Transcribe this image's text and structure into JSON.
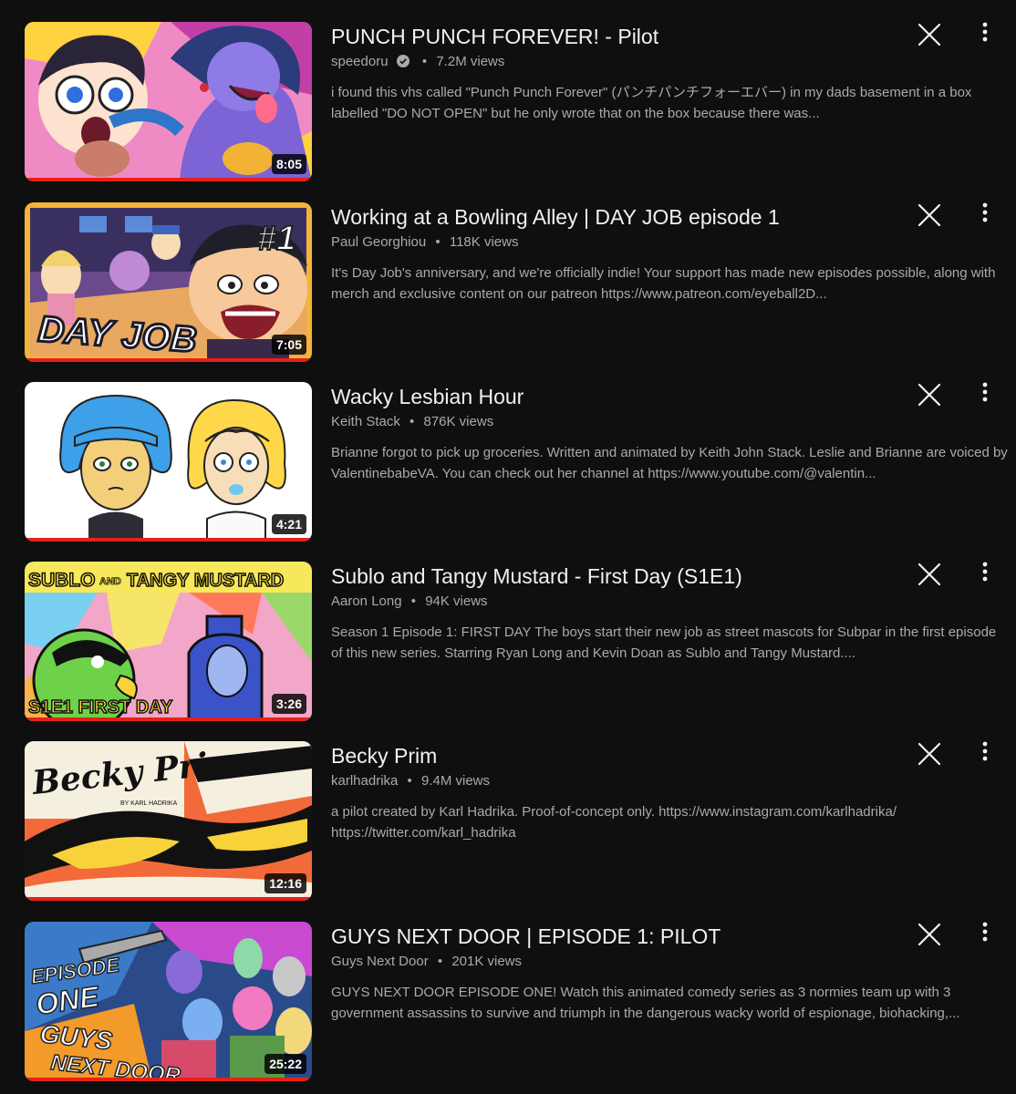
{
  "videos": [
    {
      "title": "PUNCH PUNCH FOREVER! - Pilot",
      "channel": "speedoru",
      "verified": true,
      "views": "7.2M views",
      "description": "i found this vhs called \"Punch Punch Forever\" (パンチパンチフォーエバー) in my dads basement in a box labelled \"DO NOT OPEN\" but he only wrote that on the box because there was...",
      "duration": "8:05",
      "thumbnail": "punch-punch-forever-thumbnail"
    },
    {
      "title": "Working at a Bowling Alley | DAY JOB episode 1",
      "channel": "Paul Georghiou",
      "verified": false,
      "views": "118K views",
      "description": "It's Day Job's anniversary, and we're officially indie! Your support has made new episodes possible, along with merch and exclusive content on our patreon https://www.patreon.com/eyeball2D...",
      "duration": "7:05",
      "thumbnail": "day-job-thumbnail",
      "thumb_text": [
        "#1",
        "DAY JOB"
      ]
    },
    {
      "title": "Wacky Lesbian Hour",
      "channel": "Keith Stack",
      "verified": false,
      "views": "876K views",
      "description": "Brianne forgot to pick up groceries. Written and animated by Keith John Stack. Leslie and Brianne are voiced by ValentinebabeVA. You can check out her channel at https://www.youtube.com/@valentin...",
      "duration": "4:21",
      "thumbnail": "wacky-lesbian-hour-thumbnail"
    },
    {
      "title": "Sublo and Tangy Mustard - First Day (S1E1)",
      "channel": "Aaron Long",
      "verified": false,
      "views": "94K views",
      "description": "Season 1 Episode 1: FIRST DAY The boys start their new job as street mascots for Subpar in the first episode of this new series. Starring Ryan Long and Kevin Doan as Sublo and Tangy Mustard....",
      "duration": "3:26",
      "thumbnail": "sublo-tangy-mustard-thumbnail",
      "thumb_text": [
        "SUBLO",
        "AND",
        "TANGY MUSTARD",
        "S1E1 FIRST DAY"
      ]
    },
    {
      "title": "Becky Prim",
      "channel": "karlhadrika",
      "verified": false,
      "views": "9.4M views",
      "description": "a pilot created by Karl Hadrika. Proof-of-concept only. https://www.instagram.com/karlhadrika/ https://twitter.com/karl_hadrika",
      "duration": "12:16",
      "thumbnail": "becky-prim-thumbnail",
      "thumb_text": [
        "Becky Prim",
        "BY KARL HADRIKA"
      ]
    },
    {
      "title": "GUYS NEXT DOOR | EPISODE 1: PILOT",
      "channel": "Guys Next Door",
      "verified": false,
      "views": "201K views",
      "description": "GUYS NEXT DOOR EPISODE ONE! Watch this animated comedy series as 3 normies team up with 3 government assassins to survive and triumph in the dangerous wacky world of espionage, biohacking,...",
      "duration": "25:22",
      "thumbnail": "guys-next-door-thumbnail",
      "thumb_text": [
        "EPISODE",
        "ONE",
        "GUYS",
        "NEXT DOOR"
      ]
    }
  ],
  "meta_separator": "•",
  "icons": {
    "remove": "close-icon",
    "menu": "more-vert-icon",
    "verified": "verified-check-icon"
  },
  "colors": {
    "background": "#0f0f0f",
    "title": "#f1f1f1",
    "secondary_text": "#aaaaaa",
    "progress": "#e62117"
  }
}
